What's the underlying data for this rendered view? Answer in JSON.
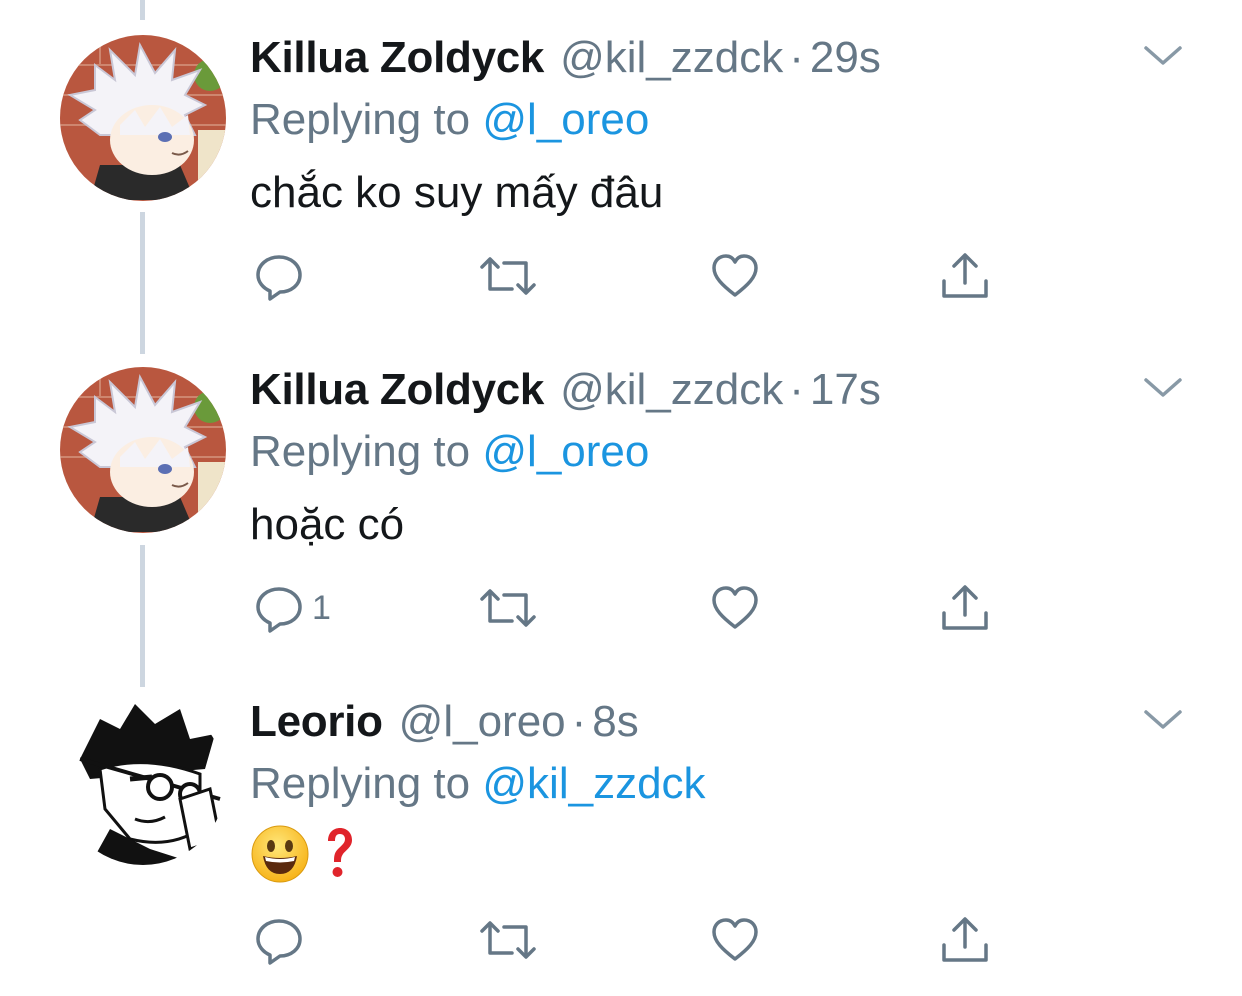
{
  "colors": {
    "text_primary": "#14171a",
    "text_secondary": "#657786",
    "link": "#1b95e0",
    "icon": "#657786",
    "thread_line": "#cdd6e0",
    "question_mark": "#e0242b"
  },
  "tweets": [
    {
      "name": "Killua Zoldyck",
      "handle": "@kil_zzdck",
      "separator": "·",
      "time": "29s",
      "replying_prefix": "Replying to",
      "replying_to": "@l_oreo",
      "text": "chắc ko suy mấy đâu",
      "avatar_icon": "killua-avatar",
      "reply_count": ""
    },
    {
      "name": "Killua Zoldyck",
      "handle": "@kil_zzdck",
      "separator": "·",
      "time": "17s",
      "replying_prefix": "Replying to",
      "replying_to": "@l_oreo",
      "text": "hoặc có",
      "avatar_icon": "killua-avatar",
      "reply_count": "1"
    },
    {
      "name": "Leorio",
      "handle": "@l_oreo",
      "separator": "·",
      "time": "8s",
      "replying_prefix": "Replying to",
      "replying_to": "@kil_zzdck",
      "text_emoji": [
        "grinning-face-emoji",
        "red-question-mark-emoji"
      ],
      "avatar_icon": "leorio-avatar",
      "reply_count": ""
    }
  ]
}
